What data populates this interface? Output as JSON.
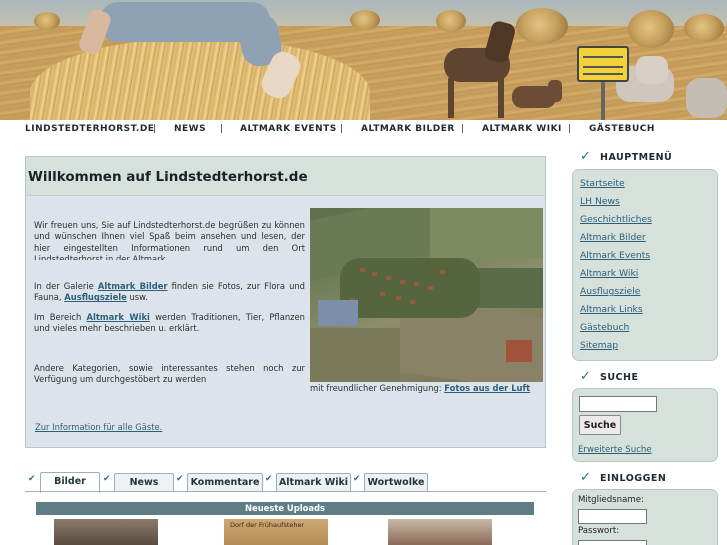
{
  "nav": {
    "items": [
      "LINDSTEDTERHORST.DE",
      "NEWS",
      "ALTMARK EVENTS",
      "ALTMARK BILDER",
      "ALTMARK WIKI",
      "GÄSTEBUCH"
    ],
    "separator": "|"
  },
  "header": {
    "sign_text": [
      "Lindstedterhorst",
      "Gemeinde Lindstedt",
      "Altmarkkreis Salzwedel"
    ]
  },
  "welcome": {
    "title": "Willkommen auf Lindstedterhorst.de",
    "p1": "Wir freuen uns, Sie auf Lindstedterhorst.de begrüßen zu können und wünschen Ihnen viel Spaß beim ansehen und lesen, der hier eingestellten Informationen rund um den Ort Lindstedterhorst in der Altmark.",
    "p2_a": "In der Galerie ",
    "p2_link1": "Altmark Bilder",
    "p2_b": " finden sie Fotos, zur Flora und Fauna, ",
    "p2_link2": "Ausflugsziele",
    "p2_c": " usw.",
    "p3_a": "Im Bereich ",
    "p3_link": "Altmark Wiki",
    "p3_b": " werden Traditionen, Tier, Pflanzen und vieles mehr beschrieben u. erklärt.",
    "p4": "Andere Kategorien, sowie interessantes stehen noch zur Verfügung um durchgestöbert zu werden",
    "guest_link": "Zur Information für alle Gäste.",
    "caption_text": "mit freundlicher Genehmigung: ",
    "caption_link": "Fotos aus der Luft"
  },
  "tabs": {
    "items": [
      "Bilder",
      "News",
      "Kommentare",
      "Altmark Wiki",
      "Wortwolke"
    ],
    "active": "Bilder",
    "check": "✔"
  },
  "uploads": {
    "title": "Neueste Uploads",
    "thumb2_caption": "Dorf der Frühaufsteher"
  },
  "sidebar": {
    "menu_title": "HAUPTMENÜ",
    "menu_items": [
      "Startseite",
      "LH News",
      "Geschichtliches",
      "Altmark Bilder",
      "Altmark Events",
      "Altmark Wiki",
      "Ausflugsziele",
      "Altmark Links",
      "Gästebuch",
      "Sitemap"
    ],
    "search_title": "SUCHE",
    "search_button": "Suche",
    "search_value": "",
    "search_advanced": "Erweiterte Suche",
    "login_title": "EINLOGGEN",
    "login_user_label": "Mitgliedsname:",
    "login_pass_label": "Passwort:",
    "check": "✓"
  }
}
